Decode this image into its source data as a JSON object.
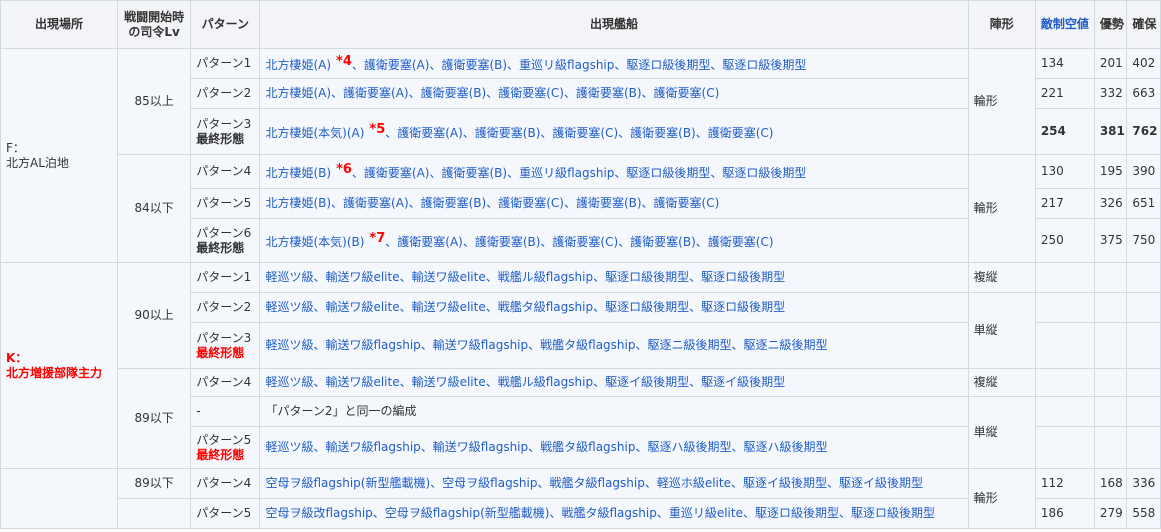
{
  "header": {
    "location": "出現場所",
    "hq_level_line1": "戦闘開始時",
    "hq_level_line2": "の司令Lv",
    "pattern": "パターン",
    "ships": "出現艦船",
    "formation": "陣形",
    "air_power": "敵制空値",
    "air_superiority": "優勢",
    "air_supremacy": "確保"
  },
  "sections": [
    {
      "location_line1": "F：",
      "location_line2": "北方AL泊地",
      "groups": [
        {
          "level": "85以上",
          "formation": "輪形",
          "rows": [
            {
              "pattern": "パターン1",
              "final": "",
              "prefix": "北方棲姫(A)",
              "fn": "*4",
              "ships": "、護衛要塞(A)、護衛要塞(B)、重巡リ級flagship、駆逐ロ級後期型、駆逐ロ級後期型",
              "air": "134",
              "sup": "201",
              "secure": "402"
            },
            {
              "pattern": "パターン2",
              "final": "",
              "prefix": "",
              "fn": "",
              "ships": "北方棲姫(A)、護衛要塞(A)、護衛要塞(B)、護衛要塞(C)、護衛要塞(B)、護衛要塞(C)",
              "air": "221",
              "sup": "332",
              "secure": "663"
            },
            {
              "pattern": "パターン3",
              "final": "最終形態",
              "prefix": "北方棲姫(本気)(A)",
              "fn": "*5",
              "ships": "、護衛要塞(A)、護衛要塞(B)、護衛要塞(C)、護衛要塞(B)、護衛要塞(C)",
              "air": "254",
              "sup": "381",
              "secure": "762",
              "bold": true
            }
          ]
        },
        {
          "level": "84以下",
          "formation": "輪形",
          "rows": [
            {
              "pattern": "パターン4",
              "final": "",
              "prefix": "北方棲姫(B)",
              "fn": "*6",
              "ships": "、護衛要塞(A)、護衛要塞(B)、重巡リ級flagship、駆逐ロ級後期型、駆逐ロ級後期型",
              "air": "130",
              "sup": "195",
              "secure": "390"
            },
            {
              "pattern": "パターン5",
              "final": "",
              "prefix": "",
              "fn": "",
              "ships": "北方棲姫(B)、護衛要塞(A)、護衛要塞(B)、護衛要塞(C)、護衛要塞(B)、護衛要塞(C)",
              "air": "217",
              "sup": "326",
              "secure": "651"
            },
            {
              "pattern": "パターン6",
              "final": "最終形態",
              "prefix": "北方棲姫(本気)(B)",
              "fn": "*7",
              "ships": "、護衛要塞(A)、護衛要塞(B)、護衛要塞(C)、護衛要塞(B)、護衛要塞(C)",
              "air": "250",
              "sup": "375",
              "secure": "750"
            }
          ]
        }
      ]
    },
    {
      "location_line1": "K：",
      "location_line2": "北方増援部隊主力",
      "rows": [
        {
          "level": "90以上",
          "pattern": "パターン1",
          "final": "",
          "ships": "軽巡ツ級、輸送ワ級elite、輸送ワ級elite、戦艦ル級flagship、駆逐ロ級後期型、駆逐ロ級後期型",
          "formation": "複縦"
        },
        {
          "pattern": "パターン2",
          "final": "",
          "ships": "軽巡ツ級、輸送ワ級elite、輸送ワ級elite、戦艦タ級flagship、駆逐ロ級後期型、駆逐ロ級後期型"
        },
        {
          "pattern": "パターン3",
          "final": "最終形態",
          "ships": "軽巡ツ級、輸送ワ級flagship、輸送ワ級flagship、戦艦タ級flagship、駆逐ニ級後期型、駆逐ニ級後期型",
          "formation": "単縦"
        },
        {
          "level": "89以下",
          "pattern": "パターン4",
          "final": "",
          "ships": "軽巡ツ級、輸送ワ級elite、輸送ワ級elite、戦艦ル級flagship、駆逐イ級後期型、駆逐イ級後期型",
          "formation": "複縦"
        },
        {
          "pattern": "-",
          "final": "",
          "ships": "「パターン2」と同一の編成",
          "formation": "単縦"
        },
        {
          "pattern": "パターン5",
          "final": "最終形態",
          "ships": "軽巡ツ級、輸送ワ級flagship、輸送ワ級flagship、戦艦タ級flagship、駆逐ハ級後期型、駆逐ハ級後期型"
        },
        {
          "level": "89以下",
          "pattern": "パターン4",
          "final": "",
          "ships": "空母ヲ級flagship(新型艦載機)、空母ヲ級flagship、戦艦タ級flagship、軽巡ホ級elite、駆逐イ級後期型、駆逐イ級後期型",
          "formation": "輪形",
          "air": "112",
          "sup": "168",
          "secure": "336"
        },
        {
          "pattern": "パターン5",
          "final": "",
          "ships": "空母ヲ級改flagship、空母ヲ級flagship(新型艦載機)、戦艦タ級flagship、重巡リ級elite、駆逐ロ級後期型、駆逐ロ級後期型",
          "air": "186",
          "sup": "279",
          "secure": "558"
        }
      ]
    }
  ]
}
